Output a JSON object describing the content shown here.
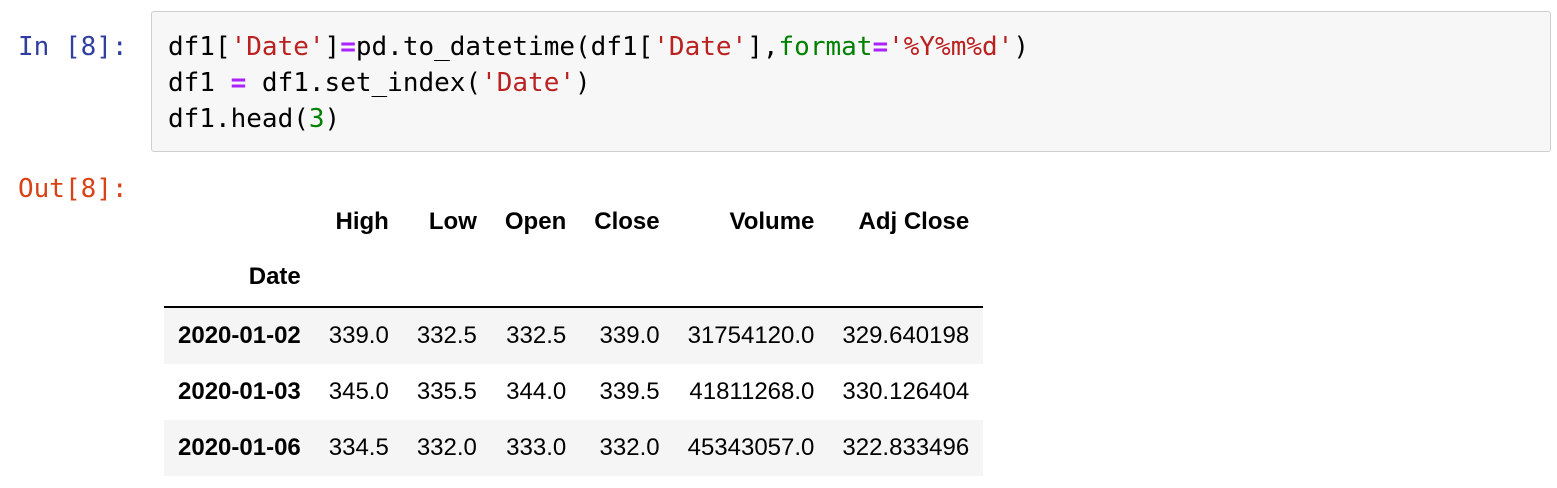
{
  "input_prompt": "In [8]:",
  "output_prompt": "Out[8]:",
  "code_lines": [
    [
      {
        "t": "df1[",
        "c": ""
      },
      {
        "t": "'Date'",
        "c": "str"
      },
      {
        "t": "]",
        "c": ""
      },
      {
        "t": "=",
        "c": "op"
      },
      {
        "t": "pd.to_datetime(df1[",
        "c": ""
      },
      {
        "t": "'Date'",
        "c": "str"
      },
      {
        "t": "],",
        "c": ""
      },
      {
        "t": "format",
        "c": "kw"
      },
      {
        "t": "=",
        "c": "op"
      },
      {
        "t": "'%Y%m%d'",
        "c": "str"
      },
      {
        "t": ")",
        "c": ""
      }
    ],
    [
      {
        "t": "df1 ",
        "c": ""
      },
      {
        "t": "=",
        "c": "op"
      },
      {
        "t": " df1.set_index(",
        "c": ""
      },
      {
        "t": "'Date'",
        "c": "str"
      },
      {
        "t": ")",
        "c": ""
      }
    ],
    [
      {
        "t": "df1.head(",
        "c": ""
      },
      {
        "t": "3",
        "c": "num"
      },
      {
        "t": ")",
        "c": ""
      }
    ]
  ],
  "dataframe": {
    "columns": [
      "High",
      "Low",
      "Open",
      "Close",
      "Volume",
      "Adj Close"
    ],
    "index_name": "Date",
    "rows": [
      {
        "index": "2020-01-02",
        "values": [
          "339.0",
          "332.5",
          "332.5",
          "339.0",
          "31754120.0",
          "329.640198"
        ]
      },
      {
        "index": "2020-01-03",
        "values": [
          "345.0",
          "335.5",
          "344.0",
          "339.5",
          "41811268.0",
          "330.126404"
        ]
      },
      {
        "index": "2020-01-06",
        "values": [
          "334.5",
          "332.0",
          "333.0",
          "332.0",
          "45343057.0",
          "322.833496"
        ]
      }
    ]
  },
  "colors": {
    "in_prompt": "#303f9f",
    "out_prompt": "#d84315",
    "string": "#ba2121",
    "operator": "#aa22ff",
    "keyword": "#008000",
    "number": "#008000",
    "cell_background": "#f7f7f7",
    "row_stripe": "#f5f5f5"
  }
}
